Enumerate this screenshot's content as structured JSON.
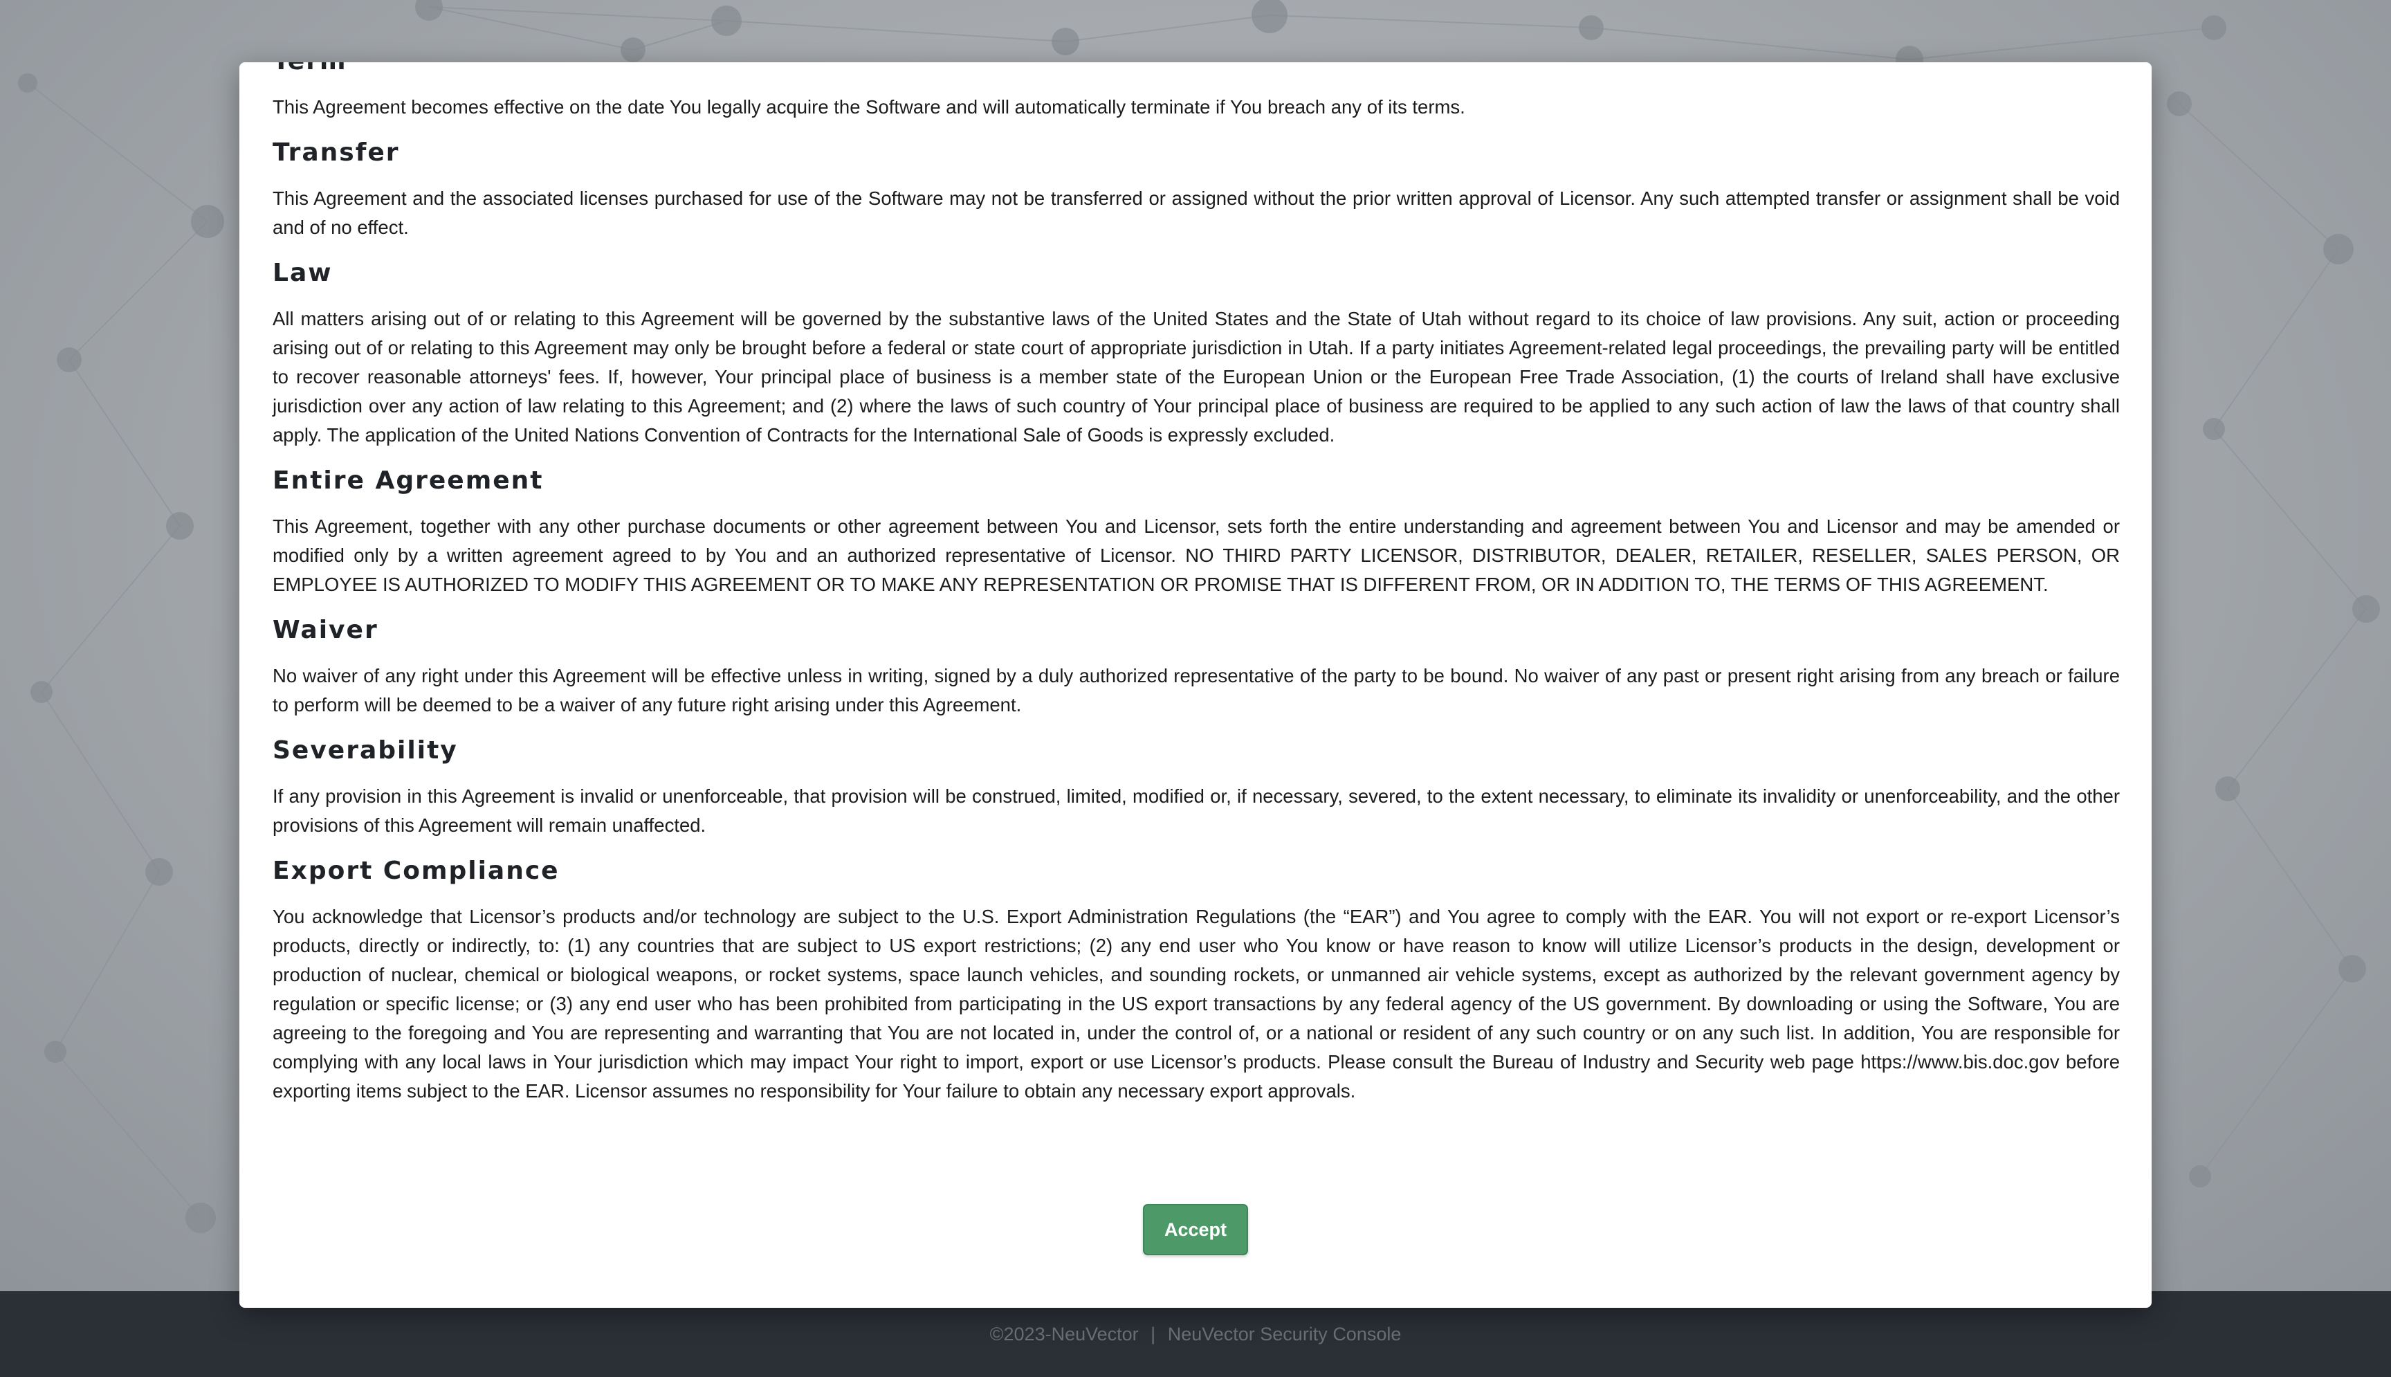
{
  "license": {
    "sections": [
      {
        "title": "Term",
        "text": "This Agreement becomes effective on the date You legally acquire the Software and will automatically terminate if You breach any of its terms."
      },
      {
        "title": "Transfer",
        "text": "This Agreement and the associated licenses purchased for use of the Software may not be transferred or assigned without the prior written approval of Licensor. Any such attempted transfer or assignment shall be void and of no effect."
      },
      {
        "title": "Law",
        "text": "All matters arising out of or relating to this Agreement will be governed by the substantive laws of the United States and the State of Utah without regard to its choice of law provisions. Any suit, action or proceeding arising out of or relating to this Agreement may only be brought before a federal or state court of appropriate jurisdiction in Utah. If a party initiates Agreement-related legal proceedings, the prevailing party will be entitled to recover reasonable attorneys' fees. If, however, Your principal place of business is a member state of the European Union or the European Free Trade Association, (1) the courts of Ireland shall have exclusive jurisdiction over any action of law relating to this Agreement; and (2) where the laws of such country of Your principal place of business are required to be applied to any such action of law the laws of that country shall apply. The application of the United Nations Convention of Contracts for the International Sale of Goods is expressly excluded."
      },
      {
        "title": "Entire Agreement",
        "text": "This Agreement, together with any other purchase documents or other agreement between You and Licensor, sets forth the entire understanding and agreement between You and Licensor and may be amended or modified only by a written agreement agreed to by You and an authorized representative of Licensor. NO THIRD PARTY LICENSOR, DISTRIBUTOR, DEALER, RETAILER, RESELLER, SALES PERSON, OR EMPLOYEE IS AUTHORIZED TO MODIFY THIS AGREEMENT OR TO MAKE ANY REPRESENTATION OR PROMISE THAT IS DIFFERENT FROM, OR IN ADDITION TO, THE TERMS OF THIS AGREEMENT."
      },
      {
        "title": "Waiver",
        "text": "No waiver of any right under this Agreement will be effective unless in writing, signed by a duly authorized representative of the party to be bound. No waiver of any past or present right arising from any breach or failure to perform will be deemed to be a waiver of any future right arising under this Agreement."
      },
      {
        "title": "Severability",
        "text": "If any provision in this Agreement is invalid or unenforceable, that provision will be construed, limited, modified or, if necessary, severed, to the extent necessary, to eliminate its invalidity or unenforceability, and the other provisions of this Agreement will remain unaffected."
      },
      {
        "title": "Export Compliance",
        "text": "You acknowledge that Licensor’s products and/or technology are subject to the U.S. Export Administration Regulations (the “EAR”) and You agree to comply with the EAR. You will not export or re-export Licensor’s products, directly or indirectly, to: (1) any countries that are subject to US export restrictions; (2) any end user who You know or have reason to know will utilize Licensor’s products in the design, development or production of nuclear, chemical or biological weapons, or rocket systems, space launch vehicles, and sounding rockets, or unmanned air vehicle systems, except as authorized by the relevant government agency by regulation or specific license; or (3) any end user who has been prohibited from participating in the US export transactions by any federal agency of the US government. By downloading or using the Software, You are agreeing to the foregoing and You are representing and warranting that You are not located in, under the control of, or a national or resident of any such country or on any such list. In addition, You are responsible for complying with any local laws in Your jurisdiction which may impact Your right to import, export or use Licensor’s products. Please consult the Bureau of Industry and Security web page https://www.bis.doc.gov before exporting items subject to the EAR. Licensor assumes no responsibility for Your failure to obtain any necessary export approvals."
      }
    ],
    "accept_label": "Accept"
  },
  "footer": {
    "copyright": "©2023-NeuVector",
    "separator": "|",
    "product": "NeuVector Security Console"
  },
  "colors": {
    "accept_button": "#4d9a68",
    "footer_bg": "#2b3037",
    "overlay_bg": "#a6aaae"
  }
}
